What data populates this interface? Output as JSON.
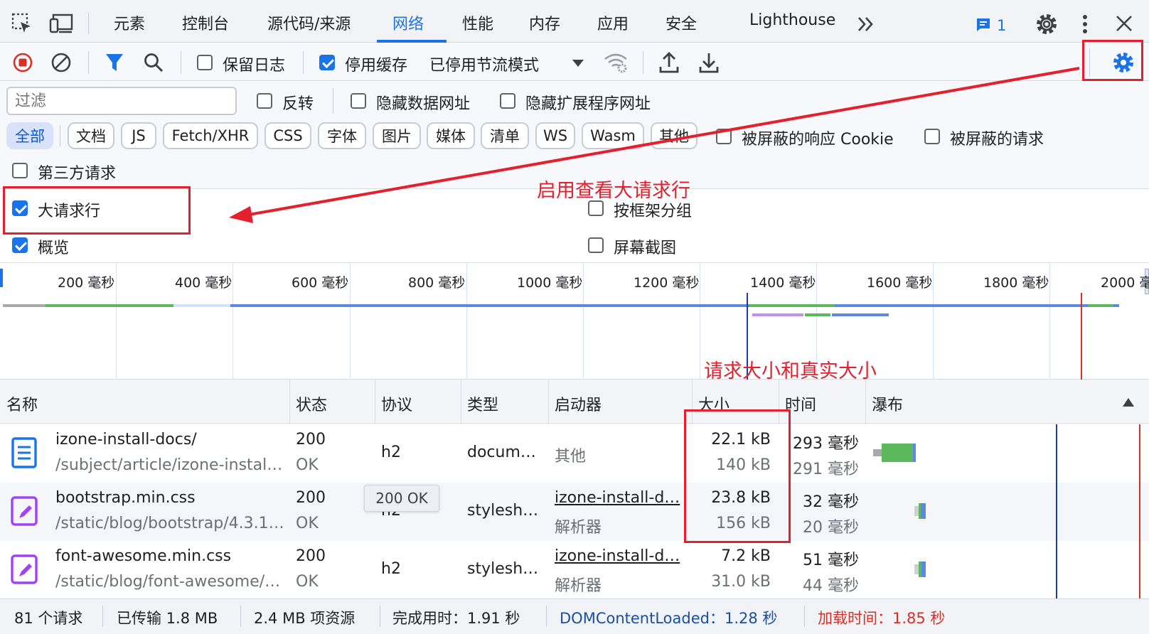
{
  "tabs": [
    "元素",
    "控制台",
    "源代码/来源",
    "网络",
    "性能",
    "内存",
    "应用",
    "安全",
    "Lighthouse"
  ],
  "active_tab": "网络",
  "more_tabs_icon": "double-chevron-right-icon",
  "messages_count": "1",
  "toolbar": {
    "preserve_log_label": "保留日志",
    "disable_cache_label": "停用缓存",
    "throttle_value": "已停用节流模式"
  },
  "filter": {
    "placeholder": "过滤",
    "invert_label": "反转",
    "hide_data_urls_label": "隐藏数据网址",
    "hide_extension_urls_label": "隐藏扩展程序网址",
    "chips": [
      "全部",
      "文档",
      "JS",
      "Fetch/XHR",
      "CSS",
      "字体",
      "图片",
      "媒体",
      "清单",
      "WS",
      "Wasm",
      "其他"
    ],
    "blocked_cookies_label": "被屏蔽的响应 Cookie",
    "blocked_requests_label": "被屏蔽的请求",
    "third_party_label": "第三方请求"
  },
  "settings": {
    "big_rows_label": "大请求行",
    "overview_label": "概览",
    "group_by_frame_label": "按框架分组",
    "screenshots_label": "屏幕截图"
  },
  "timeline": {
    "ticks": [
      "200 毫秒",
      "400 毫秒",
      "600 毫秒",
      "800 毫秒",
      "1000 毫秒",
      "1200 毫秒",
      "1400 毫秒",
      "1600 毫秒",
      "1800 毫秒",
      "2000 毫秒"
    ]
  },
  "table": {
    "headers": {
      "name": "名称",
      "status": "状态",
      "protocol": "协议",
      "type": "类型",
      "initiator": "启动器",
      "size": "大小",
      "time": "时间",
      "waterfall": "瀑布"
    },
    "rows": [
      {
        "name": "izone-install-docs/",
        "path": "/subject/article/izone-install…",
        "status_code": "200",
        "status_text": "OK",
        "protocol": "h2",
        "type": "docum…",
        "initiator": "其他",
        "initiator_sub": "",
        "size": "22.1 kB",
        "resource_size": "140 kB",
        "time": "293 毫秒",
        "latency": "291 毫秒",
        "icon": "document-icon"
      },
      {
        "name": "bootstrap.min.css",
        "path": "/static/blog/bootstrap/4.3.1…",
        "status_code": "200",
        "status_text": "OK",
        "protocol": "h2",
        "type": "stylesh…",
        "initiator": "izone-install-d…",
        "initiator_sub": "解析器",
        "size": "23.8 kB",
        "resource_size": "156 kB",
        "time": "32 毫秒",
        "latency": "20 毫秒",
        "icon": "stylesheet-icon"
      },
      {
        "name": "font-awesome.min.css",
        "path": "/static/blog/font-awesome/…",
        "status_code": "200",
        "status_text": "OK",
        "protocol": "h2",
        "type": "stylesh…",
        "initiator": "izone-install-d…",
        "initiator_sub": "解析器",
        "size": "7.2 kB",
        "resource_size": "31.0 kB",
        "time": "51 毫秒",
        "latency": "44 毫秒",
        "icon": "stylesheet-icon"
      }
    ],
    "tooltip": "200 OK"
  },
  "statusbar": {
    "requests": "81 个请求",
    "transferred": "已传输 1.8 MB",
    "resources": "2.4 MB 项资源",
    "finish": "完成用时：1.91 秒",
    "domcontentloaded": "DOMContentLoaded：1.28 秒",
    "load": "加载时间：1.85 秒"
  },
  "annotations": {
    "enable_big_rows": "启用查看大请求行",
    "size_note": "请求大小和真实大小"
  },
  "colors": {
    "accent": "#1a73e8",
    "annotation_red": "#e5202e",
    "domcontentloaded_blue": "#1a4fa0",
    "load_red": "#d93025"
  }
}
